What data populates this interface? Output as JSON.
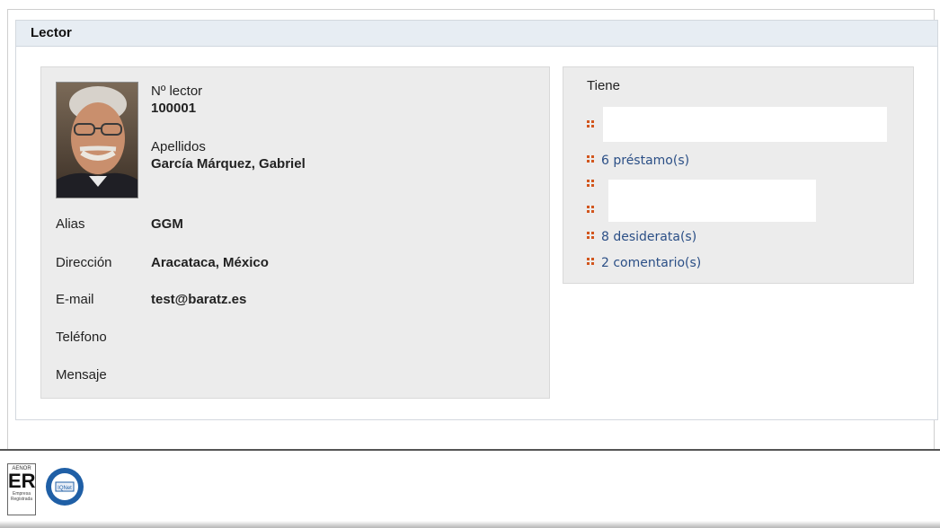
{
  "panel": {
    "title": "Lector"
  },
  "reader": {
    "number_label": "Nº lector",
    "number_value": "100001",
    "surname_label": "Apellidos",
    "surname_value": "García Márquez, Gabriel",
    "fields": [
      {
        "label": "Alias",
        "value": "GGM"
      },
      {
        "label": "Dirección",
        "value": "Aracataca, México"
      },
      {
        "label": "E-mail",
        "value": "test@baratz.es"
      },
      {
        "label": "Teléfono",
        "value": ""
      },
      {
        "label": "Mensaje",
        "value": ""
      }
    ]
  },
  "has": {
    "title": "Tiene",
    "links": [
      {
        "text": "6 préstamo(s)"
      },
      {
        "text": "8 desiderata(s)"
      },
      {
        "text": "2 comentario(s)"
      }
    ]
  },
  "footer": {
    "er_logo": {
      "top": "AENOR",
      "mark": "ER",
      "bottom": "Empresa Registrada"
    },
    "iqnet_logo": {
      "text": "IQNet"
    }
  },
  "colors": {
    "bullet": "#d2561e",
    "link": "#2b4f86",
    "header_bg": "#e7edf3",
    "box_bg": "#ececec"
  }
}
